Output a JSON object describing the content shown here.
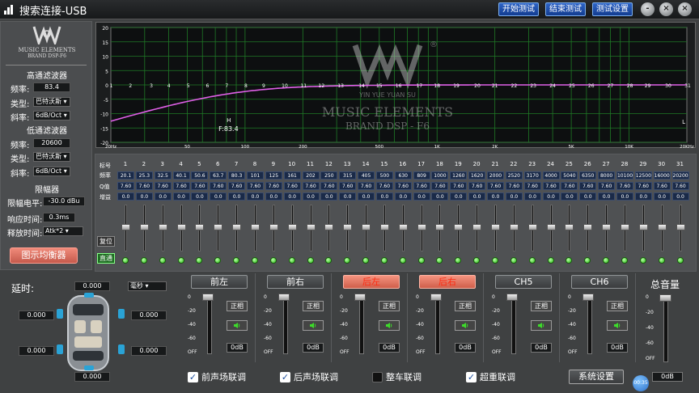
{
  "window": {
    "title": "搜索连接-USB",
    "buttons": [
      "开始测试",
      "结束测试",
      "测试设置"
    ],
    "controls": [
      "-",
      "×",
      "×"
    ]
  },
  "left": {
    "hpf": {
      "title": "高通滤波器",
      "freq_label": "频率:",
      "freq": "83.4",
      "type_label": "类型:",
      "type": "巴特沃斯",
      "slope_label": "斜率:",
      "slope": "6dB/Oct"
    },
    "lpf": {
      "title": "低通滤波器",
      "freq_label": "频率:",
      "freq": "20600",
      "type_label": "类型:",
      "type": "巴特沃斯",
      "slope_label": "斜率:",
      "slope": "6dB/Oct"
    },
    "limiter": {
      "title": "限幅器",
      "level_label": "限幅电平:",
      "level": "-30.0 dBu",
      "attack_label": "响应时间:",
      "attack": "0.3ms",
      "release_label": "释放时间:",
      "release": "Atk*2"
    },
    "geq_button": "图示均衡器",
    "logo": "MUSIC ELEMENTS",
    "logo_sub": "BRAND DSP-F6"
  },
  "graph": {
    "y_ticks": [
      "20",
      "15",
      "10",
      "5",
      "0",
      "-5",
      "-10",
      "-15",
      "-20"
    ],
    "x_ticks": [
      "20Hz",
      "50",
      "100",
      "200",
      "500",
      "1K",
      "2K",
      "5K",
      "10K",
      "20KHz"
    ],
    "point_labels": [
      "1",
      "2",
      "3",
      "4",
      "5",
      "6",
      "7",
      "8",
      "9",
      "10",
      "11",
      "12",
      "13",
      "14",
      "15",
      "16",
      "17",
      "18",
      "19",
      "20",
      "21",
      "22",
      "23",
      "24",
      "25",
      "26",
      "27",
      "28",
      "29",
      "30",
      "31"
    ],
    "hpf_marker": "H",
    "hpf_freq": "F:83.4",
    "lpf_marker": "L",
    "watermark": {
      "brand_line": "YIN YUE YUAN SU",
      "name": "MUSIC ELEMENTS",
      "sub": "BRAND DSP - F6",
      "reg": "®"
    },
    "curve_color": "#e060e8"
  },
  "eq": {
    "row_labels": [
      "标号",
      "频率",
      "Q值",
      "增益"
    ],
    "freqs": [
      "20.1",
      "25.3",
      "32.5",
      "40.1",
      "50.6",
      "63.7",
      "80.3",
      "101",
      "125",
      "161",
      "202",
      "250",
      "315",
      "405",
      "500",
      "630",
      "809",
      "1000",
      "1260",
      "1620",
      "2000",
      "2520",
      "3170",
      "4000",
      "5040",
      "6350",
      "8000",
      "10100",
      "12500",
      "16000",
      "20200"
    ],
    "q": "7.60",
    "gain": "0.0",
    "reset": "复位",
    "bypass": "直通"
  },
  "delay": {
    "label": "延时:",
    "unit": "毫秒",
    "values": [
      "0.000",
      "0.000",
      "0.000",
      "0.000",
      "0.000",
      "0.000"
    ]
  },
  "channels": [
    {
      "name": "前左",
      "active": false
    },
    {
      "name": "前右",
      "active": false
    },
    {
      "name": "后左",
      "active": true
    },
    {
      "name": "后右",
      "active": true
    },
    {
      "name": "CH5",
      "active": false
    },
    {
      "name": "CH6",
      "active": false
    }
  ],
  "channel_common": {
    "phase": "正相",
    "db": "0dB",
    "scale": [
      "0",
      "-20",
      "-40",
      "-60",
      "OFF"
    ]
  },
  "master": {
    "label": "总音量",
    "scale": [
      "0",
      "-20",
      "-40",
      "-60",
      "OFF"
    ],
    "db": "0dB",
    "timer": "00:35"
  },
  "links": [
    {
      "label": "前声场联调",
      "checked": true
    },
    {
      "label": "后声场联调",
      "checked": true
    },
    {
      "label": "整车联调",
      "checked": false
    },
    {
      "label": "超重联调",
      "checked": true
    }
  ],
  "system_settings": "系统设置"
}
